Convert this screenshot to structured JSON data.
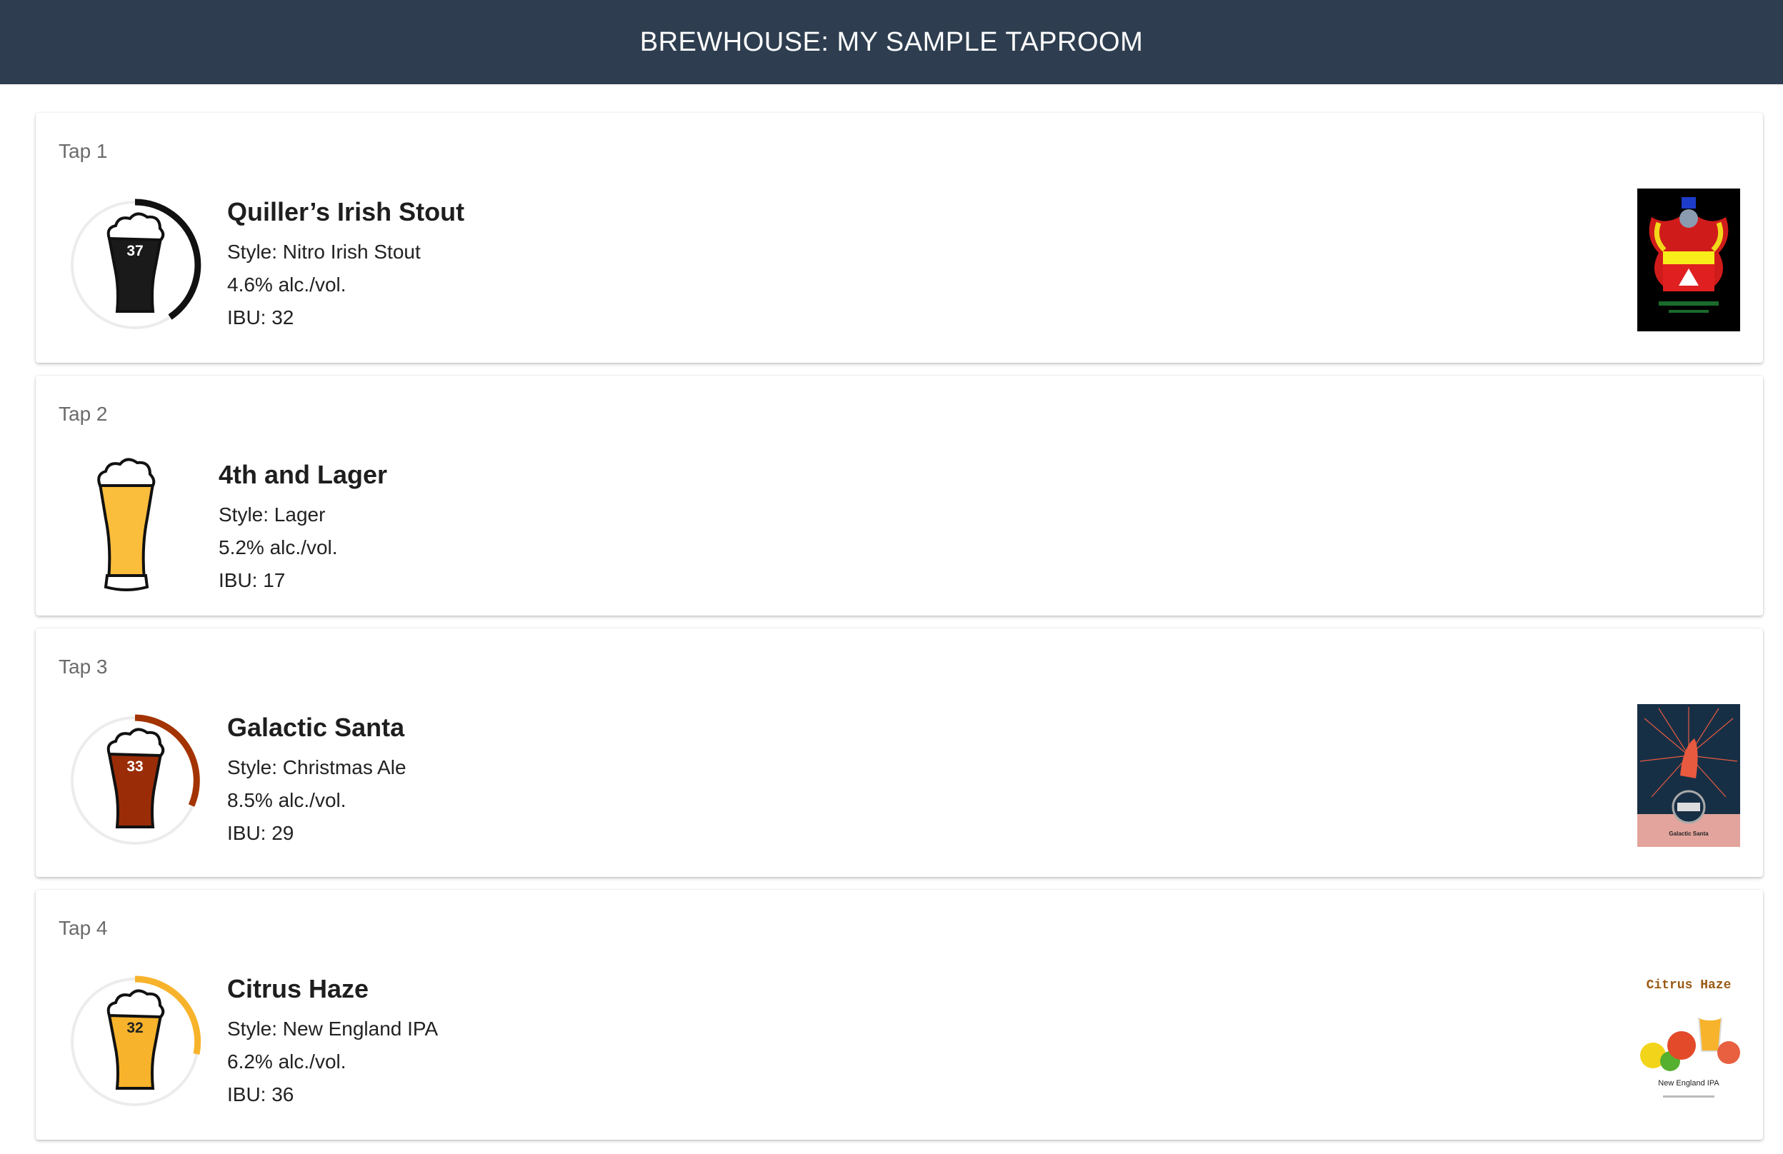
{
  "header": {
    "title": "BREWHOUSE: MY SAMPLE TAPROOM"
  },
  "taps": [
    {
      "tap_label": "Tap 1",
      "name": "Quiller’s Irish Stout",
      "style": "Style: Nitro Irish Stout",
      "abv": "4.6% alc./vol.",
      "ibu": "IBU: 32",
      "gauge_value": "37",
      "beer_color": "#1a1a1a",
      "gauge_color": "#111111",
      "label_image": "irish-crest-label"
    },
    {
      "tap_label": "Tap 2",
      "name": "4th and Lager",
      "style": "Style: Lager",
      "abv": "5.2% alc./vol.",
      "ibu": "IBU: 17",
      "beer_color": "#fbbd3c"
    },
    {
      "tap_label": "Tap 3",
      "name": "Galactic Santa",
      "style": "Style: Christmas Ale",
      "abv": "8.5% alc./vol.",
      "ibu": "IBU: 29",
      "gauge_value": "33",
      "beer_color": "#9a2d08",
      "gauge_color": "#a33300",
      "label_image": "rocket-space-label",
      "label_text": "Galactic Santa"
    },
    {
      "tap_label": "Tap 4",
      "name": "Citrus Haze",
      "style": "Style: New England IPA",
      "abv": "6.2% alc./vol.",
      "ibu": "IBU: 36",
      "gauge_value": "32",
      "beer_color": "#f7b32b",
      "gauge_color": "#f7b32b",
      "label_image": "fruit-ipa-label",
      "label_title": "Citrus Haze",
      "label_subtitle": "New England IPA"
    }
  ]
}
